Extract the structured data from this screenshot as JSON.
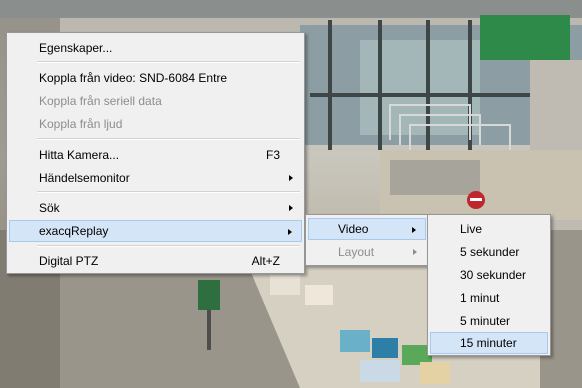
{
  "menu1": {
    "items": [
      {
        "label": "Egenskaper..."
      },
      {
        "label": "Koppla från video: SND-6084 Entre"
      },
      {
        "label": "Koppla från seriell data"
      },
      {
        "label": "Koppla från ljud"
      },
      {
        "label": "Hitta Kamera...",
        "shortcut": "F3"
      },
      {
        "label": "Händelsemonitor"
      },
      {
        "label": "Sök"
      },
      {
        "label": "exacqReplay"
      },
      {
        "label": "Digital PTZ",
        "shortcut": "Alt+Z"
      }
    ]
  },
  "menu2": {
    "items": [
      {
        "label": "Video"
      },
      {
        "label": "Layout"
      }
    ]
  },
  "menu3": {
    "items": [
      {
        "label": "Live"
      },
      {
        "label": "5 sekunder"
      },
      {
        "label": "30 sekunder"
      },
      {
        "label": "1 minut"
      },
      {
        "label": "5 minuter"
      },
      {
        "label": "15 minuter"
      }
    ]
  },
  "colors": {
    "menu_bg": "#f0f0f0",
    "highlight_bg": "#d5e5f8",
    "highlight_border": "#a9c9ef",
    "disabled_text": "#8d8d8d",
    "sign_red": "#c0272d",
    "sign_green": "#2e8a48"
  }
}
